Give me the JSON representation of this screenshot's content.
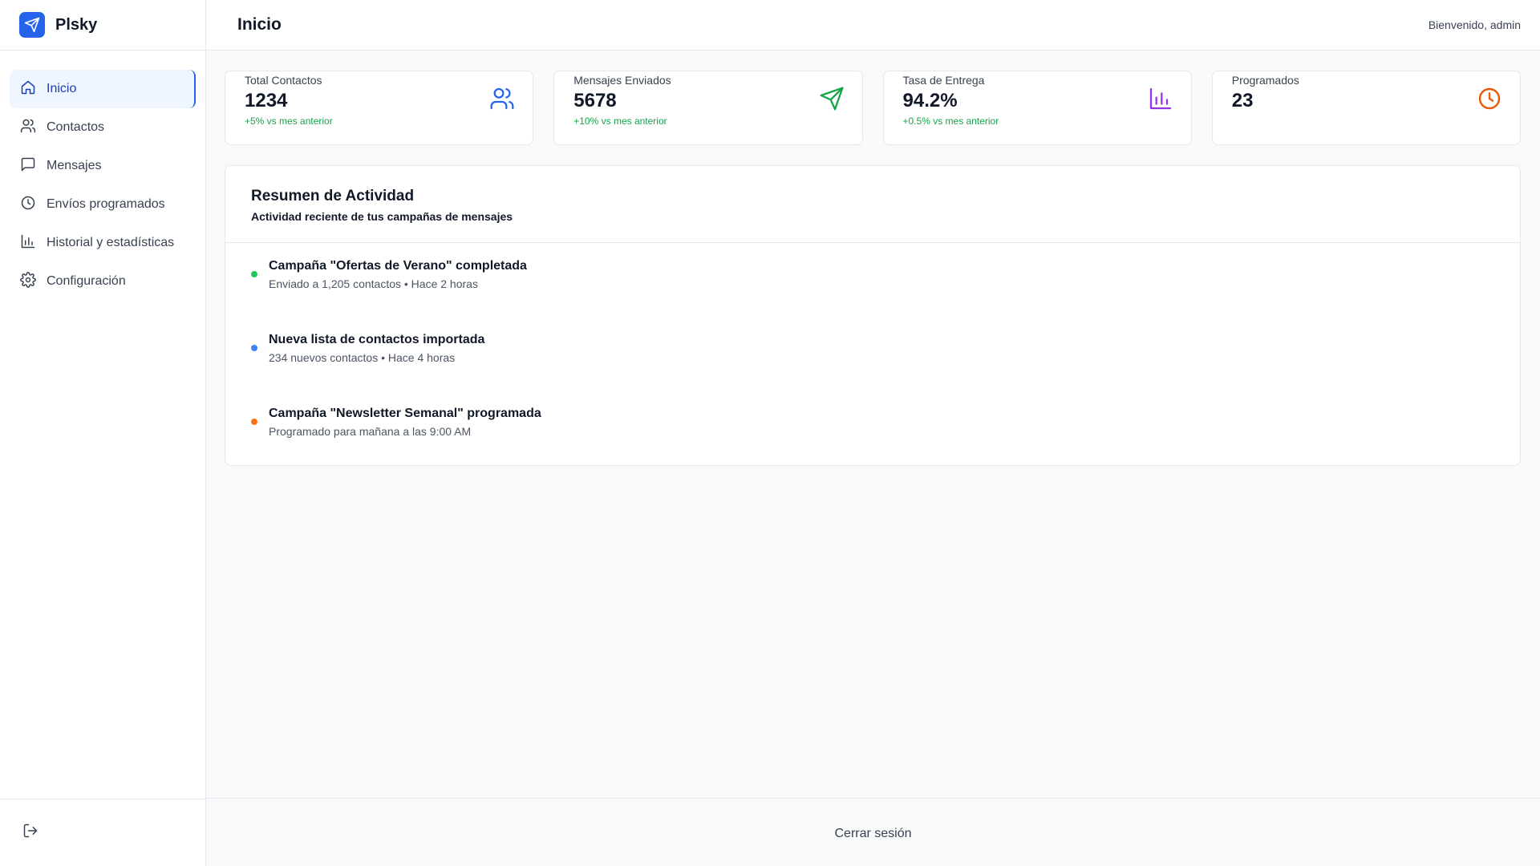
{
  "brand": {
    "name": "Plsky",
    "logo_icon": "send-icon",
    "color": "#2563eb"
  },
  "header": {
    "title": "Inicio",
    "welcome": "Bienvenido, admin"
  },
  "sidebar": {
    "items": [
      {
        "label": "Inicio",
        "icon": "home-icon",
        "active": true
      },
      {
        "label": "Contactos",
        "icon": "users-icon"
      },
      {
        "label": "Mensajes",
        "icon": "message-icon"
      },
      {
        "label": "Envíos programados",
        "icon": "clock-icon"
      },
      {
        "label": "Historial y estadísticas",
        "icon": "bar-chart-icon"
      },
      {
        "label": "Configuración",
        "icon": "gear-icon"
      }
    ],
    "footer_icon": "logout-icon"
  },
  "stats": [
    {
      "label": "Total Contactos",
      "value": "1234",
      "trend": "+5% vs mes anterior",
      "icon": "users-icon",
      "color": "#2563eb"
    },
    {
      "label": "Mensajes Enviados",
      "value": "5678",
      "trend": "+10% vs mes anterior",
      "icon": "send-icon",
      "color": "#16a34a"
    },
    {
      "label": "Tasa de Entrega",
      "value": "94.2%",
      "trend": "+0.5% vs mes anterior",
      "icon": "bar-chart-icon",
      "color": "#9333ea"
    },
    {
      "label": "Programados",
      "value": "23",
      "trend": "",
      "icon": "clock-icon",
      "color": "#ea580c"
    }
  ],
  "activity": {
    "title": "Resumen de Actividad",
    "subtitle": "Actividad reciente de tus campañas de mensajes",
    "items": [
      {
        "title": "Campaña \"Ofertas de Verano\" completada",
        "meta": "Enviado a 1,205 contactos • Hace 2 horas",
        "color": "#22c55e"
      },
      {
        "title": "Nueva lista de contactos importada",
        "meta": "234 nuevos contactos • Hace 4 horas",
        "color": "#3b82f6"
      },
      {
        "title": "Campaña \"Newsletter Semanal\" programada",
        "meta": "Programado para mañana a las 9:00 AM",
        "color": "#f97316"
      }
    ]
  },
  "footer": {
    "logout_label": "Cerrar sesión"
  }
}
